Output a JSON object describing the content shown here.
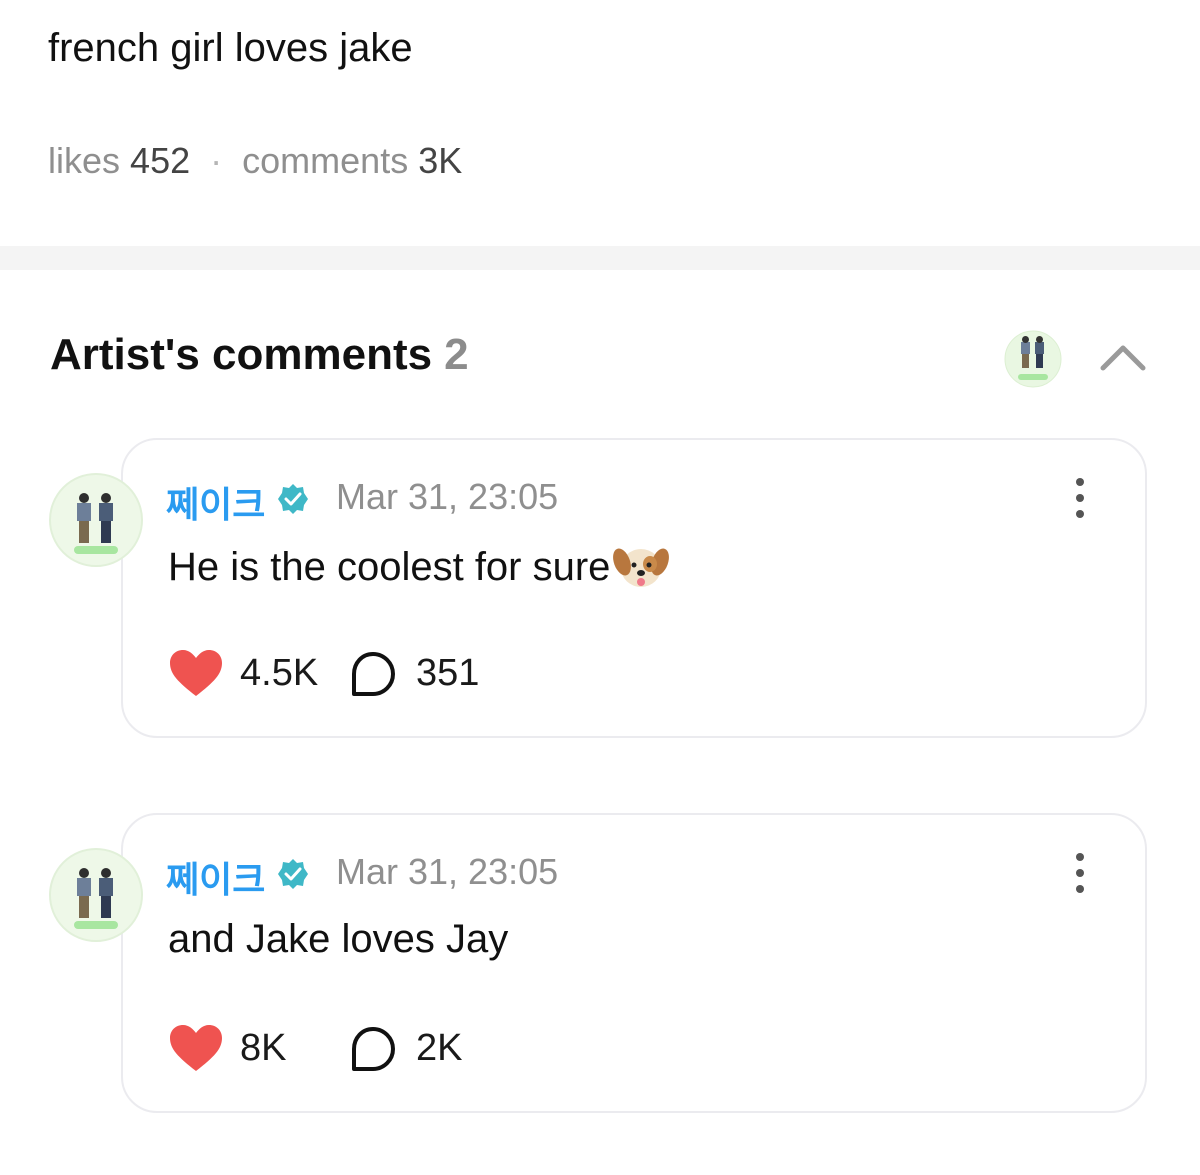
{
  "post": {
    "text": "french girl loves jake",
    "likes_label": "likes",
    "likes_count": "452",
    "separator": "·",
    "comments_label": "comments",
    "comments_count": "3K"
  },
  "artist_comments": {
    "title": "Artist's comments",
    "count": "2",
    "collapse_icon": "chevron-up-icon",
    "avatar_icon": "avatar-icon",
    "items": [
      {
        "author": "쩨이크",
        "verified_icon": "verified-badge-icon",
        "timestamp": "Mar 31, 23:05",
        "text": "He is the coolest for sure",
        "emoji": "dog-face-emoji",
        "likes": "4.5K",
        "replies": "351"
      },
      {
        "author": "쩨이크",
        "verified_icon": "verified-badge-icon",
        "timestamp": "Mar 31, 23:05",
        "text": "and Jake loves Jay",
        "likes": "8K",
        "replies": "2K"
      }
    ]
  },
  "colors": {
    "author": "#2a9bf0",
    "verified": "#3fb8c7",
    "like": "#ef5350",
    "muted": "#8f8f8f",
    "divider": "#f4f4f4",
    "card_border": "#ebebef"
  }
}
